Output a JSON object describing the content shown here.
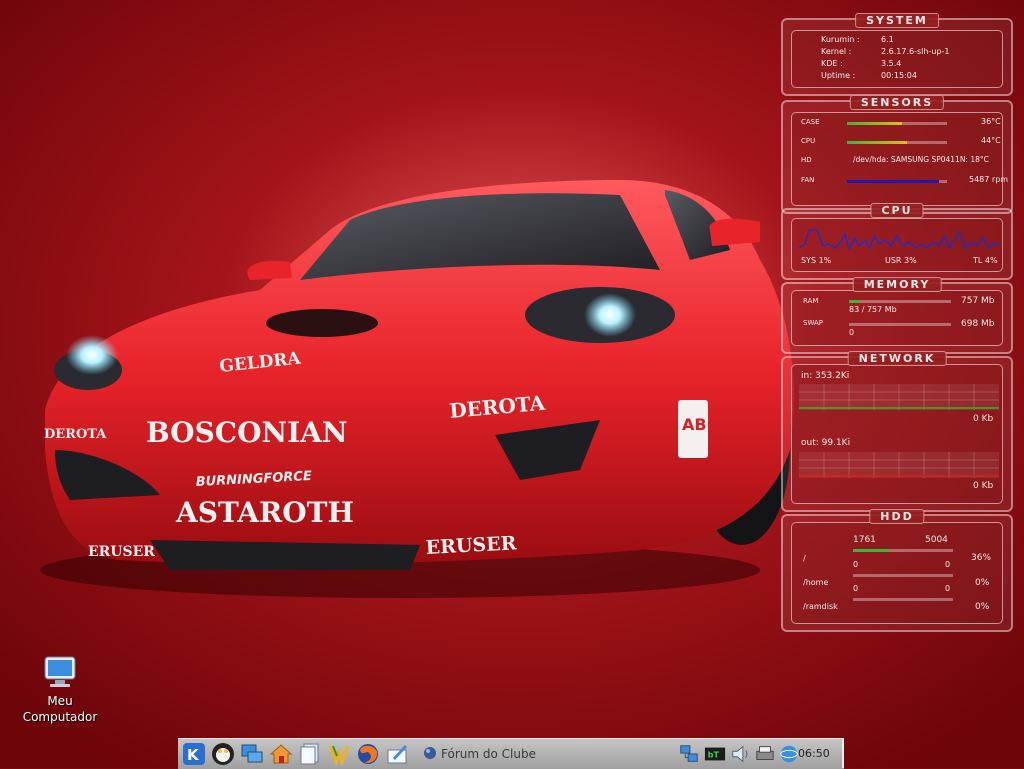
{
  "wallpaper": {
    "decals": {
      "hood_brand": "GELDRA",
      "door_brand": "BOSCONIAN",
      "fender_brand": "DEROTA",
      "left_fender": "DEROTA",
      "sponsor_small": "BURNINGFORCE",
      "sponsor_big": "ASTAROTH",
      "skirt_left": "ERUSER",
      "skirt_right": "ERUSER",
      "badge": "AB"
    }
  },
  "desktop_icon": {
    "label_line1": "Meu",
    "label_line2": "Computador",
    "icon": "monitor-icon"
  },
  "monitor": {
    "system": {
      "title": "system",
      "rows": [
        {
          "label": "Kurumin :",
          "value": "6.1"
        },
        {
          "label": "Kernel :",
          "value": "2.6.17.6-slh-up-1"
        },
        {
          "label": "KDE :",
          "value": "3.5.4"
        },
        {
          "label": "Uptime :",
          "value": "00:15:04"
        }
      ]
    },
    "sensors": {
      "title": "sensors",
      "case_label": "CASE",
      "case_value": "36°C",
      "case_level": 0.55,
      "cpu_label": "CPU",
      "cpu_value": "44°C",
      "cpu_level": 0.6,
      "hd_label": "HD",
      "hd_value": "/dev/hda: SAMSUNG SP0411N: 18°C",
      "fan_label": "FAN",
      "fan_value": "5487 rpm",
      "fan_level": 0.92
    },
    "cpu": {
      "title": "cpu",
      "sys": "SYS 1%",
      "usr": "USR 3%",
      "total": "TL 4%"
    },
    "memory": {
      "title": "memory",
      "ram_label": "RAM",
      "ram_total": "757 Mb",
      "ram_used": "83 / 757 Mb",
      "ram_level": 0.11,
      "swap_label": "SWAP",
      "swap_total": "698 Mb",
      "swap_used": "0",
      "swap_level": 0.0
    },
    "network": {
      "title": "network",
      "in_label": "in: 353.2Ki",
      "in_value": "0 Kb",
      "out_label": "out: 99.1Ki",
      "out_value": "0 Kb"
    },
    "hdd": {
      "title": "hdd",
      "rows": [
        {
          "mount": "/",
          "used": "1761",
          "total": "5004",
          "percent": "36%",
          "level": 0.36
        },
        {
          "mount": "/home",
          "used": "0",
          "total": "0",
          "percent": "0%",
          "level": 0.0
        },
        {
          "mount": "/ramdisk",
          "used": "0",
          "total": "0",
          "percent": "0%",
          "level": 0.0
        }
      ]
    }
  },
  "taskbar": {
    "task_label": "Fórum do Clube",
    "clock": "06:50",
    "icons": [
      "kde-menu-icon",
      "penguin-icon",
      "network-desktop-icon",
      "home-icon",
      "documents-icon",
      "kurumin-icon",
      "firefox-icon",
      "editor-icon"
    ],
    "tray": [
      "network-tray-icon",
      "bittorrent-tray-icon",
      "volume-icon",
      "printer-icon",
      "globe-icon"
    ]
  },
  "colors": {
    "bg_red": "#a3141a",
    "cpu_graph": "#1a2bd8",
    "net_graph": "#22c022",
    "bar_green": "#3cb43c",
    "bar_yellow": "#d8c020",
    "fan_blue": "#1a1ab0"
  }
}
